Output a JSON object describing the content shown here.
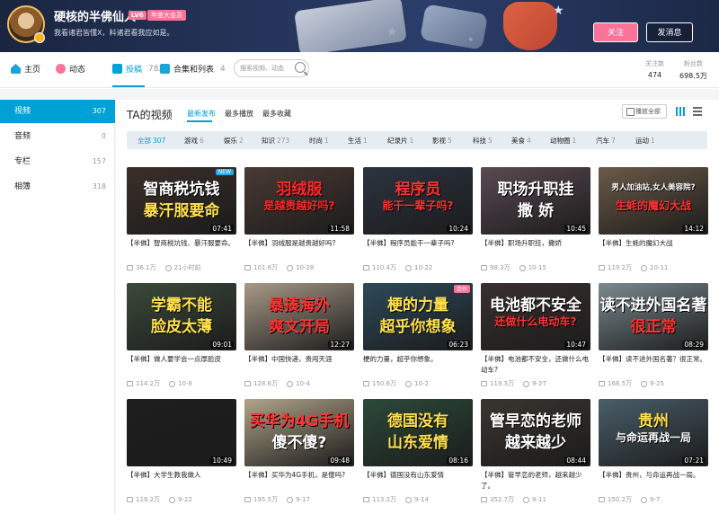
{
  "header": {
    "username": "硬核的半佛仙人",
    "level": "LV6",
    "vip_badge": "年度大会员",
    "signature": "我看诸君皆懂X，料诸君看我应如是。",
    "follow_label": "关注",
    "message_label": "发消息"
  },
  "nav": {
    "items": [
      {
        "label": "主页",
        "count": ""
      },
      {
        "label": "动态",
        "count": ""
      },
      {
        "label": "投稿",
        "count": "782"
      },
      {
        "label": "合集和列表",
        "count": "4"
      }
    ],
    "search_placeholder": "搜索视频、动态",
    "stats": [
      {
        "label": "关注数",
        "value": "474"
      },
      {
        "label": "粉丝数",
        "value": "698.5万"
      }
    ]
  },
  "sidebar": {
    "items": [
      {
        "label": "视频",
        "count": "307"
      },
      {
        "label": "音频",
        "count": "0"
      },
      {
        "label": "专栏",
        "count": "157"
      },
      {
        "label": "相簿",
        "count": "318"
      }
    ]
  },
  "content": {
    "title": "TA的视频",
    "sorts": [
      "最新发布",
      "最多播放",
      "最多收藏"
    ],
    "play_all": "播放全部",
    "filters": [
      {
        "label": "全部",
        "count": "307"
      },
      {
        "label": "游戏",
        "count": "6"
      },
      {
        "label": "娱乐",
        "count": "2"
      },
      {
        "label": "知识",
        "count": "273"
      },
      {
        "label": "时尚",
        "count": "1"
      },
      {
        "label": "生活",
        "count": "1"
      },
      {
        "label": "纪录片",
        "count": "1"
      },
      {
        "label": "影视",
        "count": "5"
      },
      {
        "label": "科技",
        "count": "5"
      },
      {
        "label": "美食",
        "count": "4"
      },
      {
        "label": "动物圈",
        "count": "1"
      },
      {
        "label": "汽车",
        "count": "7"
      },
      {
        "label": "运动",
        "count": "1"
      }
    ]
  },
  "videos": [
    {
      "t1": "智商税坑钱",
      "t2": "暴汗服要命",
      "badge": "NEW",
      "dur": "07:41",
      "title": "【半佛】智商税坑钱、暴汗服要命。",
      "plays": "36.1万",
      "time": "21小时前",
      "bg": "#3a2f2a",
      "c1": "#ffffff",
      "c2": "#ffe14d"
    },
    {
      "t1": "羽绒服",
      "t2": "是越贵越好吗?",
      "badge": "",
      "dur": "11:58",
      "title": "【半佛】羽绒服是越贵越好吗?",
      "plays": "101.6万",
      "time": "10-28",
      "bg": "#4a3a34",
      "c1": "#ff2a2a",
      "c2": "#ff2a2a"
    },
    {
      "t1": "程序员",
      "t2": "能干一辈子吗?",
      "badge": "",
      "dur": "10:24",
      "title": "【半佛】程序员能干一辈子吗?",
      "plays": "110.4万",
      "time": "10-22",
      "bg": "#2c3440",
      "c1": "#ff3333",
      "c2": "#ff3333"
    },
    {
      "t1": "职场升职挂",
      "t2": "撒 娇",
      "badge": "",
      "dur": "10:45",
      "title": "【半佛】职场升职挂，撒娇",
      "plays": "98.3万",
      "time": "10-15",
      "bg": "#5a4a52",
      "c1": "#ffffff",
      "c2": "#ffffff"
    },
    {
      "t1": "男人加油站,女人美容院?",
      "t2": "生蚝的魔幻大战",
      "badge": "",
      "dur": "14:12",
      "title": "【半佛】生蚝的魔幻大战",
      "plays": "119.2万",
      "time": "10-11",
      "bg": "#6b5a48",
      "c1": "#ffffff",
      "c2": "#ff3333"
    },
    {
      "t1": "学霸不能",
      "t2": "脸皮太薄",
      "badge": "",
      "dur": "09:01",
      "title": "【半佛】做人要学会一点厚脸皮",
      "plays": "114.2万",
      "time": "10-8",
      "bg": "#3b4a3a",
      "c1": "#ffe14d",
      "c2": "#ffe14d"
    },
    {
      "t1": "暴揍海外",
      "t2": "爽文开局",
      "badge": "",
      "dur": "12:27",
      "title": "【半佛】中国快递，贵闯天涯",
      "plays": "128.6万",
      "time": "10-4",
      "bg": "#a89a88",
      "c1": "#ff3333",
      "c2": "#ff3333"
    },
    {
      "t1": "梗的力量",
      "t2": "超乎你想象",
      "badge": "合作",
      "dur": "06:23",
      "title": "梗的力量，超乎你想象。",
      "plays": "150.6万",
      "time": "10-2",
      "bg": "#2d4a5a",
      "c1": "#ffe14d",
      "c2": "#ffe14d"
    },
    {
      "t1": "电池都不安全",
      "t2": "还做什么电动车?",
      "badge": "",
      "dur": "10:47",
      "title": "【半佛】电池都不安全，还做什么电动车?",
      "plays": "119.3万",
      "time": "9-27",
      "bg": "#3a3030",
      "c1": "#ffffff",
      "c2": "#ff3333"
    },
    {
      "t1": "读不进外国名著",
      "t2": "很正常",
      "badge": "",
      "dur": "08:29",
      "title": "【半佛】读不进外国名著？很正常。",
      "plays": "168.5万",
      "time": "9-25",
      "bg": "#7a8a90",
      "c1": "#ffffff",
      "c2": "#ff3333"
    },
    {
      "t1": "",
      "t2": "",
      "badge": "",
      "dur": "10:49",
      "title": "【半佛】大学生教我做人",
      "plays": "119.2万",
      "time": "9-22",
      "bg": "#1e1e1e",
      "c1": "#ffffff",
      "c2": "#ffffff"
    },
    {
      "t1": "买华为4G手机",
      "t2": "傻不傻?",
      "badge": "",
      "dur": "09:48",
      "title": "【半佛】买华为4G手机，是傻吗?",
      "plays": "195.5万",
      "time": "9-17",
      "bg": "#b0a48a",
      "c1": "#ff3333",
      "c2": "#ffffff"
    },
    {
      "t1": "德国没有",
      "t2": "山东爱情",
      "badge": "",
      "dur": "08:16",
      "title": "【半佛】德国没有山东爱情",
      "plays": "113.2万",
      "time": "9-14",
      "bg": "#2c4a3a",
      "c1": "#ffe14d",
      "c2": "#ffe14d"
    },
    {
      "t1": "管早恋的老师",
      "t2": "越来越少",
      "badge": "",
      "dur": "08:44",
      "title": "【半佛】管早恋的老师，越来越少了。",
      "plays": "352.7万",
      "time": "9-11",
      "bg": "#3a3530",
      "c1": "#ffffff",
      "c2": "#ffffff"
    },
    {
      "t1": "贵州",
      "t2": "与命运再战一局",
      "badge": "",
      "dur": "07:21",
      "title": "【半佛】贵州，与命运再战一局。",
      "plays": "150.2万",
      "time": "9-7",
      "bg": "#4a5e6a",
      "c1": "#ffe14d",
      "c2": "#ffffff"
    }
  ],
  "colors": {
    "accent": "#00a1d6",
    "pink": "#fb7299"
  }
}
